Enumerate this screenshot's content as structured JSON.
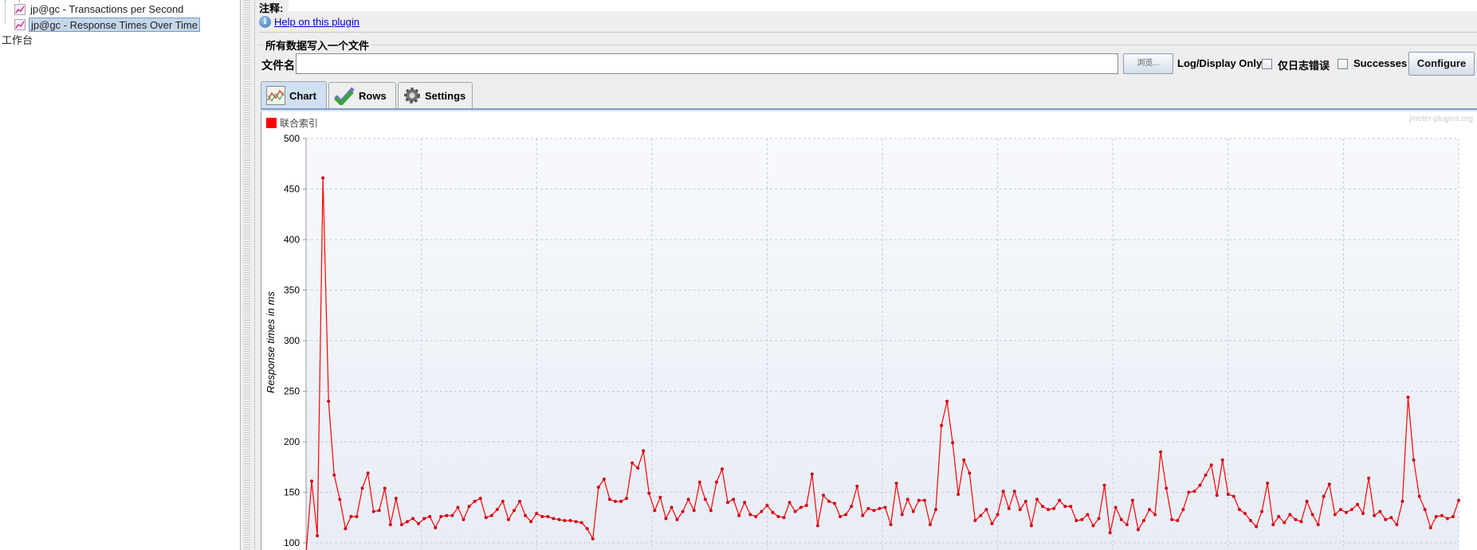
{
  "tree": {
    "items": [
      {
        "label": "jp@gc - Transactions per Second",
        "selected": false,
        "icon": "graph-icon"
      },
      {
        "label": "jp@gc - Response Times Over Time",
        "selected": true,
        "icon": "graph-icon"
      }
    ],
    "workbench": "工作台"
  },
  "comment_label": "注释:",
  "help_link": "Help on this plugin",
  "file_group": {
    "title": "所有数据写入一个文件",
    "filename_label": "文件名",
    "filename_value": "",
    "browse_label": "浏览...",
    "log_display_only": "Log/Display Only:",
    "errors_only_label": "仅日志错误",
    "errors_only_checked": false,
    "successes_label": "Successes",
    "successes_checked": false,
    "configure_label": "Configure"
  },
  "tabs": [
    {
      "label": "Chart",
      "icon": "chart-icon",
      "active": true
    },
    {
      "label": "Rows",
      "icon": "checkmark-icon",
      "active": false
    },
    {
      "label": "Settings",
      "icon": "gear-icon",
      "active": false
    }
  ],
  "watermark": "jmeter-plugins.org",
  "chart_data": {
    "type": "line",
    "ylabel": "Response times in ms",
    "yticks": [
      100,
      150,
      200,
      250,
      300,
      350,
      400,
      450,
      500
    ],
    "ylim": [
      100,
      500
    ],
    "grid": true,
    "legend_position": "top-left",
    "series": [
      {
        "name": "联合索引",
        "color": "#ff0000",
        "values": [
          90,
          161,
          107,
          461,
          240,
          167,
          143,
          114,
          126,
          126,
          154,
          169,
          131,
          132,
          154,
          118,
          144,
          118,
          121,
          124,
          119,
          124,
          126,
          115,
          126,
          127,
          127,
          135,
          123,
          136,
          141,
          144,
          125,
          127,
          133,
          141,
          123,
          132,
          141,
          127,
          121,
          129,
          126,
          126,
          124,
          123,
          122,
          122,
          121,
          120,
          114,
          104,
          155,
          163,
          143,
          141,
          141,
          144,
          179,
          174,
          191,
          149,
          132,
          145,
          124,
          135,
          123,
          131,
          143,
          132,
          160,
          143,
          132,
          160,
          173,
          140,
          143,
          127,
          140,
          128,
          126,
          131,
          137,
          130,
          126,
          125,
          140,
          131,
          135,
          137,
          168,
          117,
          147,
          141,
          139,
          126,
          128,
          136,
          156,
          127,
          134,
          132,
          134,
          135,
          118,
          159,
          128,
          143,
          131,
          142,
          142,
          118,
          133,
          216,
          240,
          199,
          148,
          182,
          169,
          122,
          127,
          133,
          119,
          128,
          151,
          134,
          151,
          133,
          141,
          117,
          143,
          136,
          133,
          134,
          142,
          136,
          136,
          122,
          123,
          128,
          117,
          124,
          157,
          110,
          135,
          123,
          118,
          142,
          113,
          122,
          133,
          128,
          190,
          154,
          123,
          122,
          133,
          150,
          151,
          157,
          167,
          177,
          147,
          182,
          148,
          146,
          133,
          129,
          122,
          116,
          131,
          159,
          118,
          126,
          120,
          128,
          123,
          121,
          141,
          128,
          118,
          146,
          158,
          128,
          133,
          130,
          133,
          138,
          129,
          164,
          127,
          131,
          123,
          125,
          118,
          141,
          244,
          182,
          146,
          133,
          115,
          126,
          127,
          124,
          126,
          142
        ]
      }
    ]
  }
}
